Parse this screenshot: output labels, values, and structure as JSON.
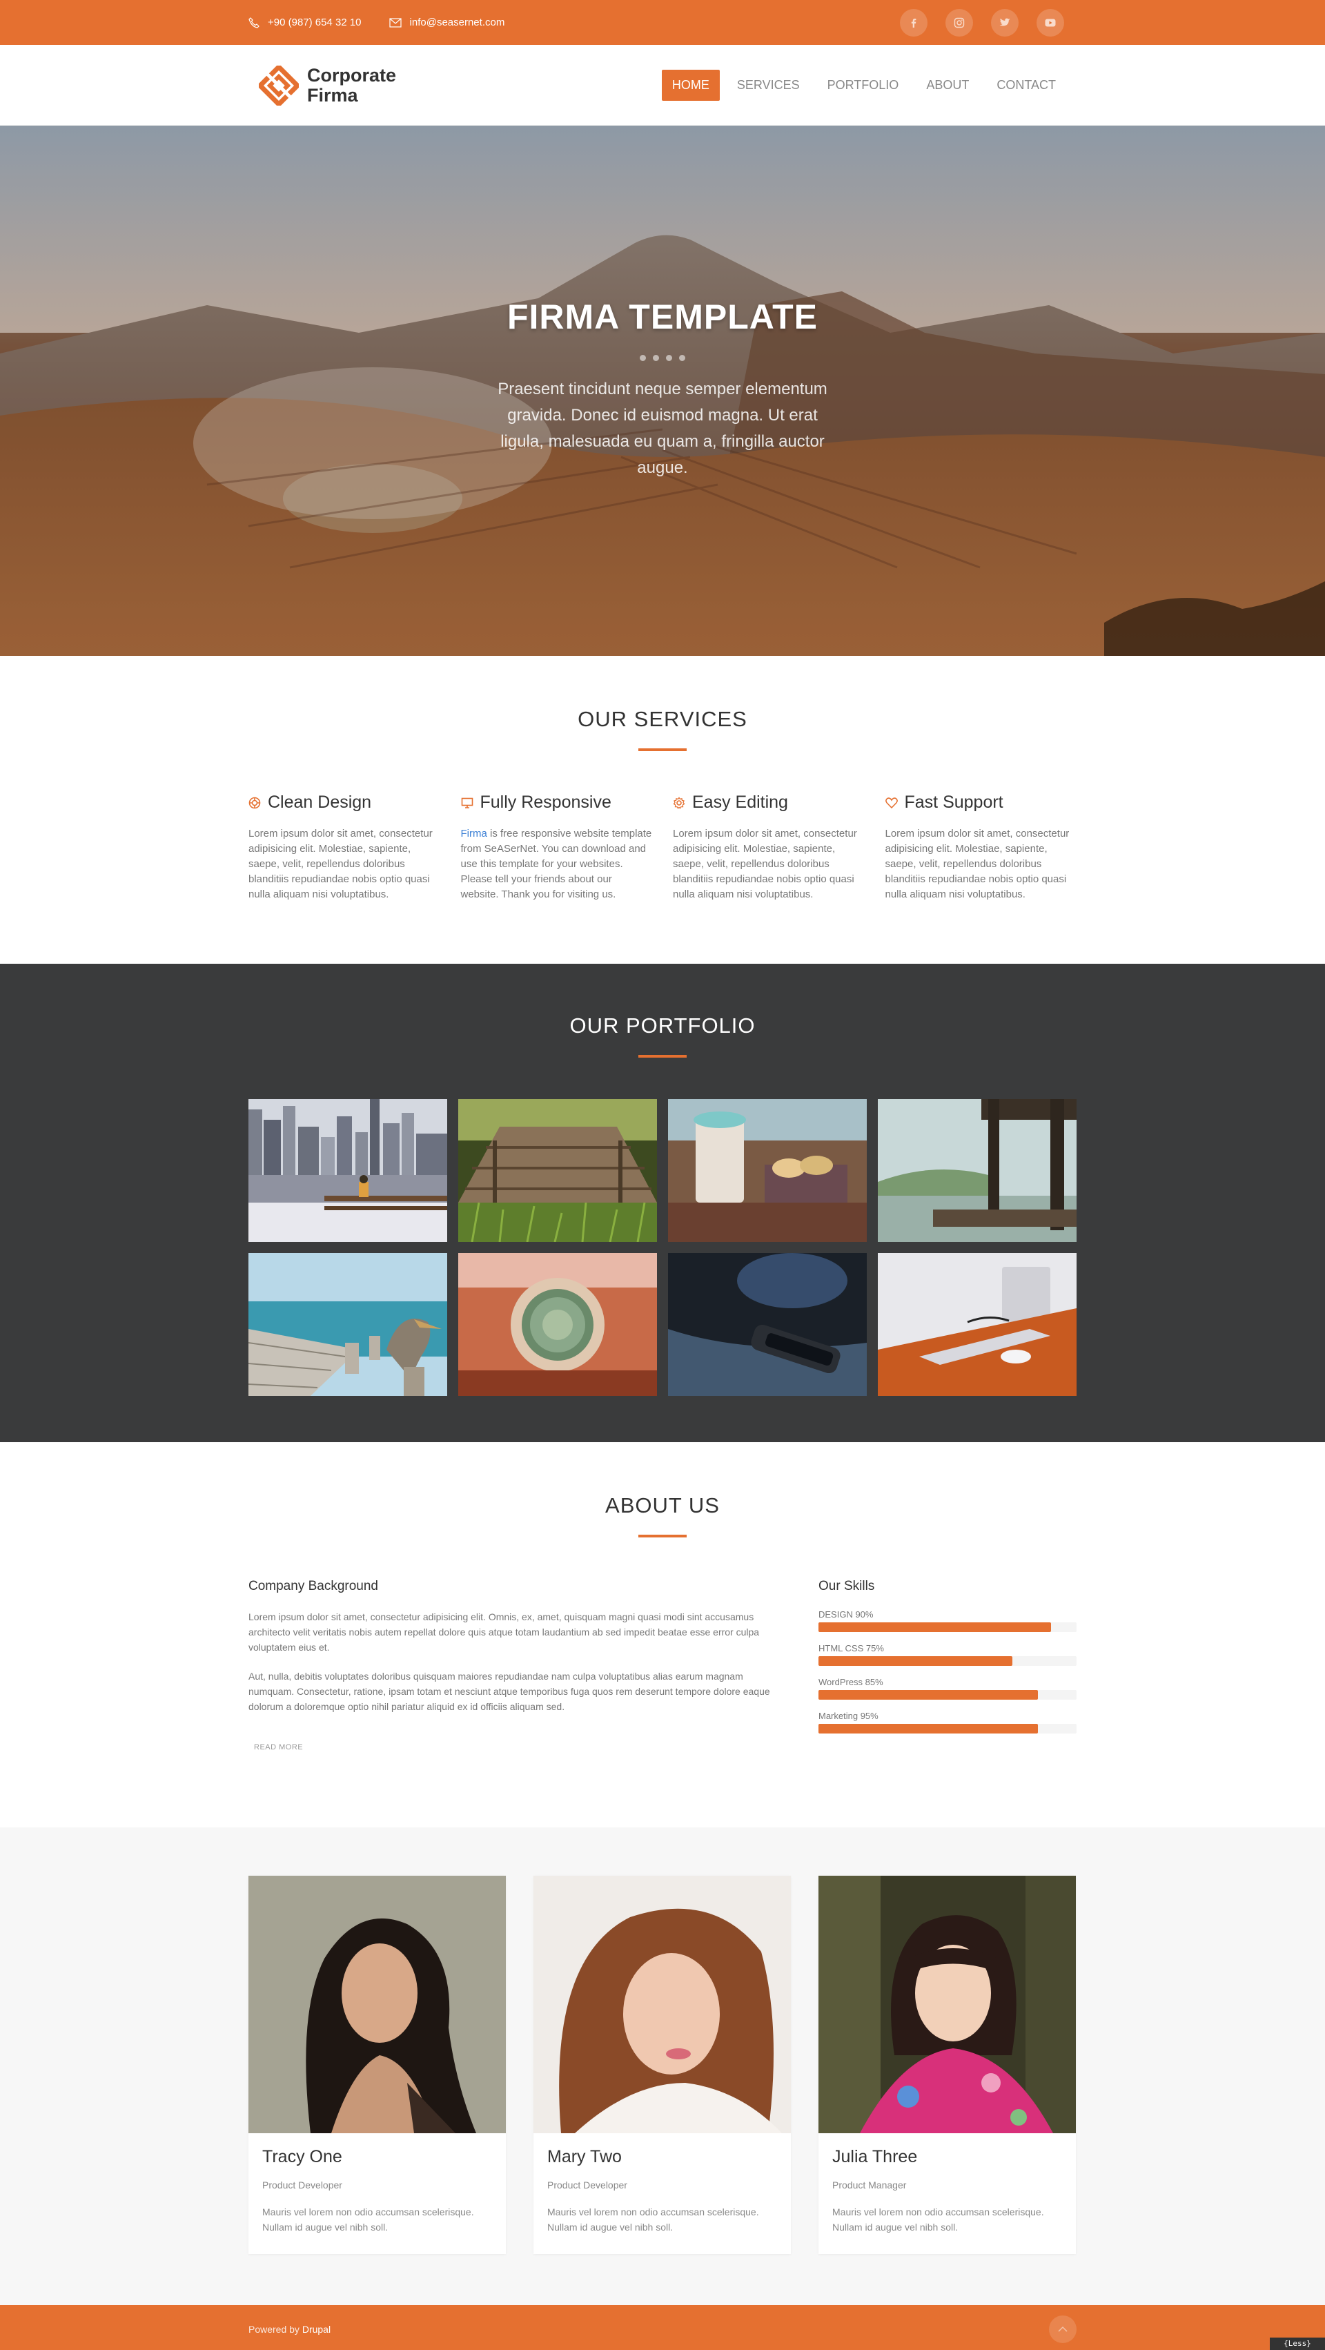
{
  "topbar": {
    "phone": "+90 (987) 654 32 10",
    "email": "info@seasernet.com",
    "socials": [
      "facebook-icon",
      "instagram-icon",
      "twitter-icon",
      "youtube-icon"
    ]
  },
  "header": {
    "logo_line1": "Corporate",
    "logo_line2": "Firma",
    "nav": [
      "HOME",
      "SERVICES",
      "PORTFOLIO",
      "ABOUT",
      "CONTACT"
    ],
    "active_nav": "HOME"
  },
  "hero": {
    "title": "FIRMA TEMPLATE",
    "text": "Praesent tincidunt neque semper elementum gravida. Donec id euismod magna. Ut erat ligula, malesuada eu quam a, fringilla auctor augue."
  },
  "services": {
    "title": "OUR SERVICES",
    "items": [
      {
        "icon": "lifebuoy-icon",
        "title": "Clean Design",
        "text": "Lorem ipsum dolor sit amet, consectetur adipisicing elit. Molestiae, sapiente, saepe, velit, repellendus doloribus blanditiis repudiandae nobis optio quasi nulla aliquam nisi voluptatibus."
      },
      {
        "icon": "monitor-icon",
        "title": "Fully Responsive",
        "link": "Firma",
        "text": " is free responsive website template from SeASerNet. You can download and use this template for your websites. Please tell your friends about our website. Thank you for visiting us."
      },
      {
        "icon": "gear-icon",
        "title": "Easy Editing",
        "text": "Lorem ipsum dolor sit amet, consectetur adipisicing elit. Molestiae, sapiente, saepe, velit, repellendus doloribus blanditiis repudiandae nobis optio quasi nulla aliquam nisi voluptatibus."
      },
      {
        "icon": "heart-icon",
        "title": "Fast Support",
        "text": "Lorem ipsum dolor sit amet, consectetur adipisicing elit. Molestiae, sapiente, saepe, velit, repellendus doloribus blanditiis repudiandae nobis optio quasi nulla aliquam nisi voluptatibus."
      }
    ]
  },
  "portfolio": {
    "title": "OUR PORTFOLIO",
    "images": [
      "city-bench-photo",
      "wooden-pier-photo",
      "coffee-cookies-photo",
      "lake-dock-photo",
      "pelican-pier-photo",
      "cactus-photo",
      "smartphone-photo",
      "desk-laptop-photo"
    ]
  },
  "about": {
    "title": "ABOUT US",
    "background_title": "Company Background",
    "paragraph1": "Lorem ipsum dolor sit amet, consectetur adipisicing elit. Omnis, ex, amet, quisquam magni quasi modi sint accusamus architecto velit veritatis nobis autem repellat dolore quis atque totam laudantium ab sed impedit beatae esse error culpa voluptatem eius et.",
    "paragraph2": "Aut, nulla, debitis voluptates doloribus quisquam maiores repudiandae nam culpa voluptatibus alias earum magnam numquam. Consectetur, ratione, ipsam totam et nesciunt atque temporibus fuga quos rem deserunt tempore dolore eaque dolorum a doloremque optio nihil pariatur aliquid ex id officiis aliquam sed.",
    "read_more": "READ MORE",
    "skills_title": "Our Skills",
    "skills": [
      {
        "label": "DESIGN 90%",
        "percent": 90
      },
      {
        "label": "HTML CSS 75%",
        "percent": 75
      },
      {
        "label": "WordPress 85%",
        "percent": 85
      },
      {
        "label": "Marketing 95%",
        "percent": 85
      }
    ]
  },
  "team": {
    "members": [
      {
        "name": "Tracy One",
        "role": "Product Developer",
        "text": "Mauris vel lorem non odio accumsan scelerisque. Nullam id augue vel nibh soll."
      },
      {
        "name": "Mary Two",
        "role": "Product Developer",
        "text": "Mauris vel lorem non odio accumsan scelerisque. Nullam id augue vel nibh soll."
      },
      {
        "name": "Julia Three",
        "role": "Product Manager",
        "text": "Mauris vel lorem non odio accumsan scelerisque. Nullam id augue vel nibh soll."
      }
    ]
  },
  "footer": {
    "powered_by": "Powered by ",
    "drupal": "Drupal",
    "less_badge": "{Less}"
  },
  "colors": {
    "accent": "#e57030",
    "dark": "#3a3b3c"
  }
}
